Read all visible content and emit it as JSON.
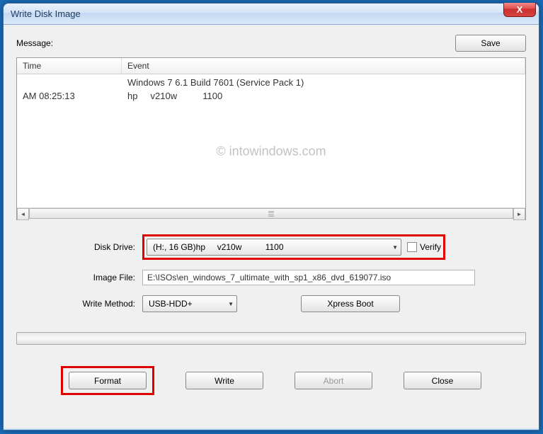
{
  "window": {
    "title": "Write Disk Image",
    "close_glyph": "X"
  },
  "message": {
    "label": "Message:",
    "save_label": "Save",
    "columns": {
      "time": "Time",
      "event": "Event"
    },
    "rows": [
      {
        "time": "",
        "event": "Windows 7 6.1 Build 7601 (Service Pack 1)"
      },
      {
        "time": "AM 08:25:13",
        "event": "hp     v210w          1100"
      }
    ],
    "watermark": "© intowindows.com"
  },
  "fields": {
    "disk_drive_label": "Disk Drive:",
    "disk_drive_value": "(H:, 16 GB)hp     v210w          1100",
    "verify_label": "Verify",
    "verify_checked": false,
    "image_file_label": "Image File:",
    "image_file_value": "E:\\ISOs\\en_windows_7_ultimate_with_sp1_x86_dvd_619077.iso",
    "write_method_label": "Write Method:",
    "write_method_value": "USB-HDD+",
    "xpress_boot_label": "Xpress Boot"
  },
  "buttons": {
    "format": "Format",
    "write": "Write",
    "abort": "Abort",
    "close": "Close"
  },
  "scroll": {
    "left_glyph": "◄",
    "right_glyph": "►"
  },
  "dropdown_glyph": "▼"
}
